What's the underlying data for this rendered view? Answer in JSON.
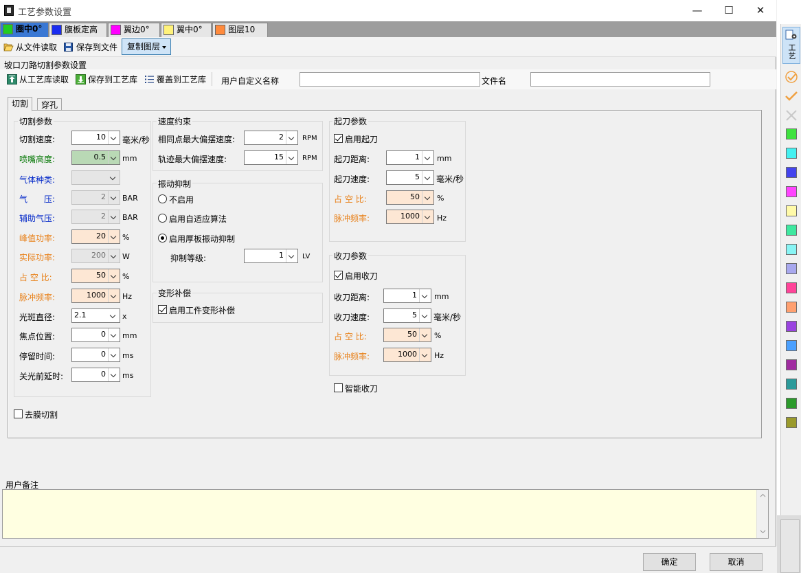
{
  "window": {
    "title": "工艺参数设置",
    "min": "—",
    "max": "☐",
    "close": "✕"
  },
  "layer_tabs": [
    {
      "label": "圈中0°",
      "color": "#22cc22"
    },
    {
      "label": "腹板定高",
      "color": "#1a2cf0"
    },
    {
      "label": "翼边0°",
      "color": "#ff00ff"
    },
    {
      "label": "翼中0°",
      "color": "#fff27a"
    },
    {
      "label": "图层10",
      "color": "#ff8a3c"
    }
  ],
  "toolbar": {
    "read_file": "从文件读取",
    "save_file": "保存到文件",
    "copy_layer": "复制图层"
  },
  "section_title": "坡口刀路切割参数设置",
  "toolbar2": {
    "read_lib": "从工艺库读取",
    "save_lib": "保存到工艺库",
    "cover_lib": "覆盖到工艺库",
    "custom_name_label": "用户自定义名称",
    "custom_name_value": "",
    "file_name_label": "文件名",
    "file_name_value": ""
  },
  "tabs": {
    "cut": "切割",
    "pierce": "穿孔"
  },
  "cut_params": {
    "title": "切割参数",
    "speed": {
      "label": "切割速度:",
      "value": "10",
      "unit": "毫米/秒"
    },
    "nozzle": {
      "label": "喷嘴高度:",
      "value": "0.5",
      "unit": "mm"
    },
    "gas": {
      "label": "气体种类:",
      "value": ""
    },
    "pressure": {
      "label": "气　　压:",
      "value": "2",
      "unit": "BAR"
    },
    "aux_pressure": {
      "label": "辅助气压:",
      "value": "2",
      "unit": "BAR"
    },
    "peak_power": {
      "label": "峰值功率:",
      "value": "20",
      "unit": "%"
    },
    "actual_power": {
      "label": "实际功率:",
      "value": "200",
      "unit": "W"
    },
    "duty": {
      "label": "占 空 比:",
      "value": "50",
      "unit": "%"
    },
    "pulse_freq": {
      "label": "脉冲频率:",
      "value": "1000",
      "unit": "Hz"
    },
    "spot": {
      "label": "光斑直径:",
      "value": "2.1",
      "unit": "x"
    },
    "focus": {
      "label": "焦点位置:",
      "value": "0",
      "unit": "mm"
    },
    "dwell": {
      "label": "停留时间:",
      "value": "0",
      "unit": "ms"
    },
    "off_delay": {
      "label": "关光前延时:",
      "value": "0",
      "unit": "ms"
    }
  },
  "film_cut": {
    "label": "去膜切割",
    "checked": false
  },
  "speed_limit": {
    "title": "速度约束",
    "same_point": {
      "label": "相同点最大偏摆速度:",
      "value": "2",
      "unit": "RPM"
    },
    "track": {
      "label": "轨迹最大偏摆速度:",
      "value": "15",
      "unit": "RPM"
    }
  },
  "vibration": {
    "title": "振动抑制",
    "options": [
      "不启用",
      "启用自适应算法",
      "启用厚板振动抑制"
    ],
    "selected_index": 2,
    "level": {
      "label": "抑制等级:",
      "value": "1",
      "unit": "LV"
    }
  },
  "deform": {
    "title": "变形补偿",
    "enable": "启用工件变形补偿",
    "checked": true
  },
  "lead_in": {
    "title": "起刀参数",
    "enable": "启用起刀",
    "checked": true,
    "distance": {
      "label": "起刀距离:",
      "value": "1",
      "unit": "mm"
    },
    "speed": {
      "label": "起刀速度:",
      "value": "5",
      "unit": "毫米/秒"
    },
    "duty": {
      "label": "占 空 比:",
      "value": "50",
      "unit": "%"
    },
    "pulse": {
      "label": "脉冲频率:",
      "value": "1000",
      "unit": "Hz"
    }
  },
  "lead_out": {
    "title": "收刀参数",
    "enable": "启用收刀",
    "checked": true,
    "distance": {
      "label": "收刀距离:",
      "value": "1",
      "unit": "mm"
    },
    "speed": {
      "label": "收刀速度:",
      "value": "5",
      "unit": "毫米/秒"
    },
    "duty": {
      "label": "占 空 比:",
      "value": "50",
      "unit": "%"
    },
    "pulse": {
      "label": "脉冲频率:",
      "value": "1000",
      "unit": "Hz"
    }
  },
  "smart_leadout": {
    "label": "智能收刀",
    "checked": false
  },
  "notes": {
    "label": "用户备注",
    "value": ""
  },
  "buttons": {
    "ok": "确定",
    "cancel": "取消"
  },
  "right_panel": {
    "tool_label": "工艺",
    "palette": [
      "#3fe23f",
      "#44f0f0",
      "#4444ee",
      "#ff44ff",
      "#fffaa8",
      "#3ee8a0",
      "#88f4f4",
      "#a8a8ee",
      "#ff4499",
      "#ffa070",
      "#9a44e0",
      "#4aa0ff",
      "#a02ca0",
      "#2c9a9a",
      "#2c9a2c",
      "#9a9a2c"
    ]
  }
}
